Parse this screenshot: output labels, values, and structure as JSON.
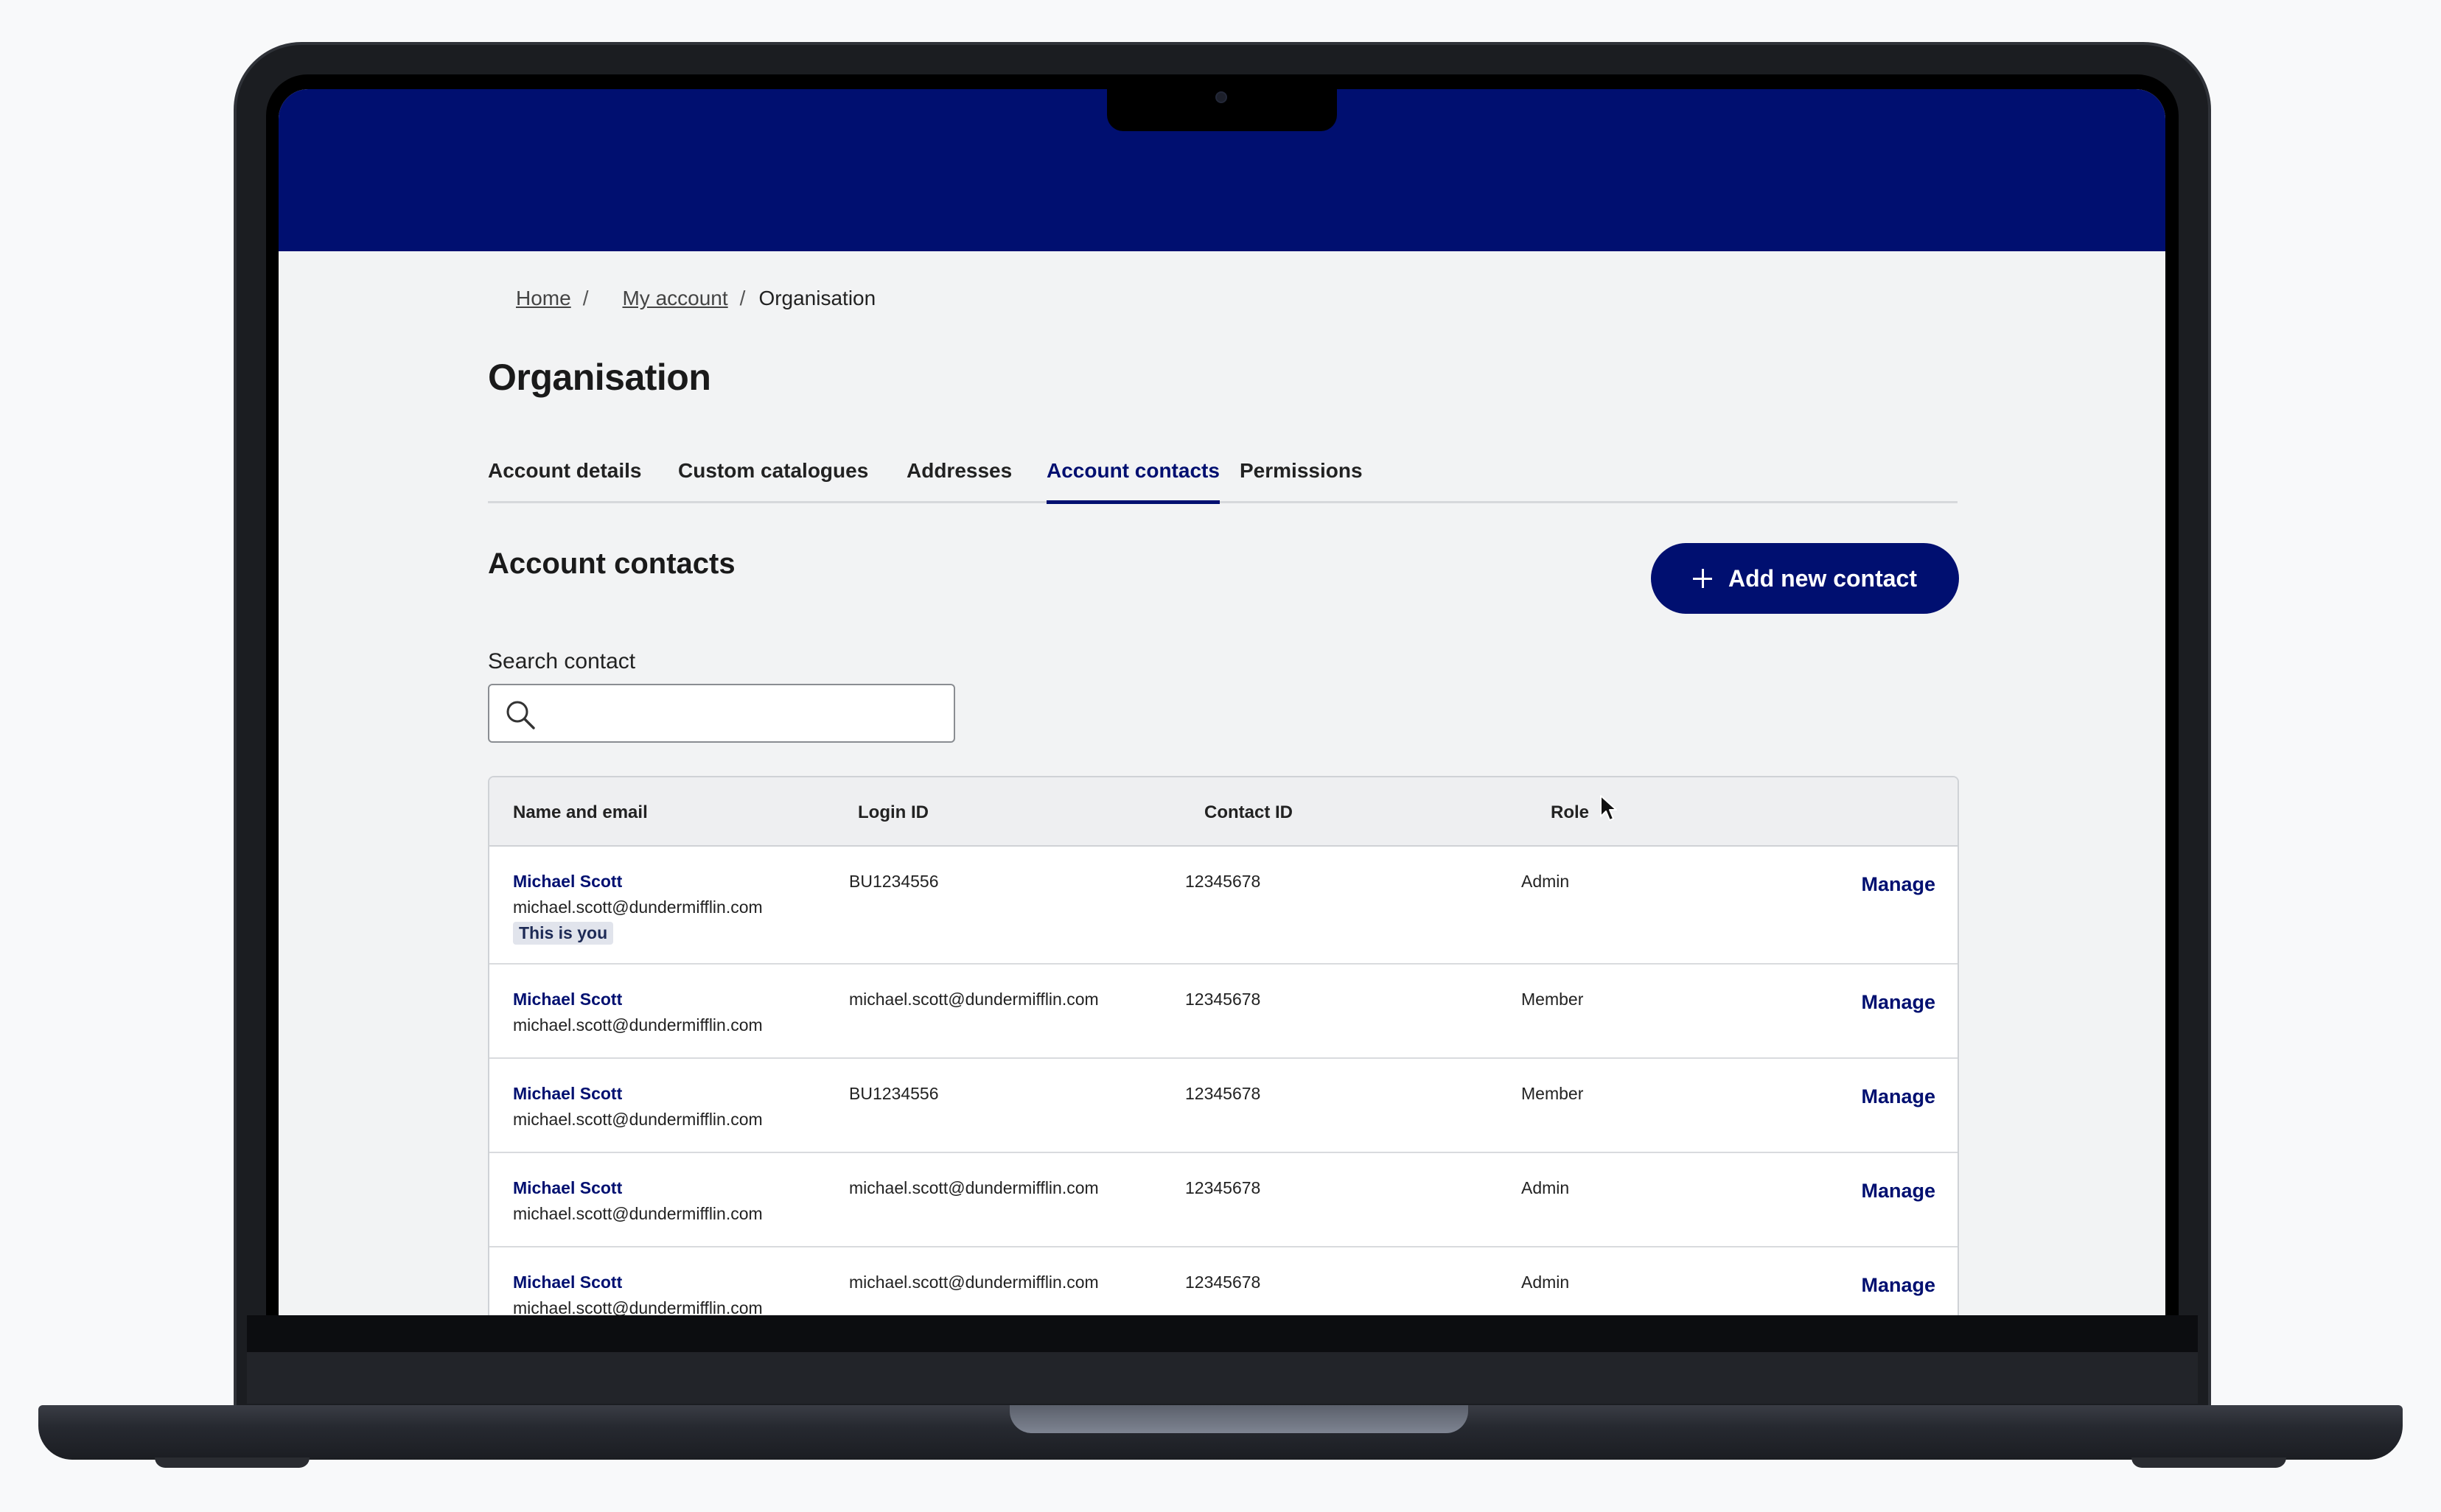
{
  "breadcrumb": {
    "home": "Home",
    "my_account": "My account",
    "current": "Organisation",
    "separator": "/"
  },
  "page_title": "Organisation",
  "tabs": [
    {
      "label": "Account details",
      "active": false
    },
    {
      "label": "Custom catalogues",
      "active": false
    },
    {
      "label": "Addresses",
      "active": false
    },
    {
      "label": "Account contacts",
      "active": true
    },
    {
      "label": "Permissions",
      "active": false
    }
  ],
  "section": {
    "title": "Account contacts",
    "add_button_label": "Add new contact",
    "add_button_icon": "plus-icon"
  },
  "search": {
    "label": "Search contact",
    "value": "",
    "icon": "search-icon"
  },
  "table": {
    "headers": {
      "name_email": "Name and email",
      "login_id": "Login ID",
      "contact_id": "Contact ID",
      "role": "Role"
    },
    "rows": [
      {
        "name": "Michael Scott",
        "email": "michael.scott@dundermifflin.com",
        "badge": "This is you",
        "login_id": "BU1234556",
        "contact_id": "12345678",
        "role": "Admin",
        "action": "Manage"
      },
      {
        "name": "Michael Scott",
        "email": "michael.scott@dundermifflin.com",
        "badge": "",
        "login_id": "michael.scott@dundermifflin.com",
        "contact_id": "12345678",
        "role": "Member",
        "action": "Manage"
      },
      {
        "name": "Michael Scott",
        "email": "michael.scott@dundermifflin.com",
        "badge": "",
        "login_id": "BU1234556",
        "contact_id": "12345678",
        "role": "Member",
        "action": "Manage"
      },
      {
        "name": "Michael Scott",
        "email": "michael.scott@dundermifflin.com",
        "badge": "",
        "login_id": "michael.scott@dundermifflin.com",
        "contact_id": "12345678",
        "role": "Admin",
        "action": "Manage"
      },
      {
        "name": "Michael Scott",
        "email": "michael.scott@dundermifflin.com",
        "badge": "",
        "login_id": "michael.scott@dundermifflin.com",
        "contact_id": "12345678",
        "role": "Admin",
        "action": "Manage"
      }
    ]
  },
  "colors": {
    "brand_navy": "#000f70",
    "page_background": "#f2f3f4",
    "badge_background": "#e1e4ec"
  }
}
